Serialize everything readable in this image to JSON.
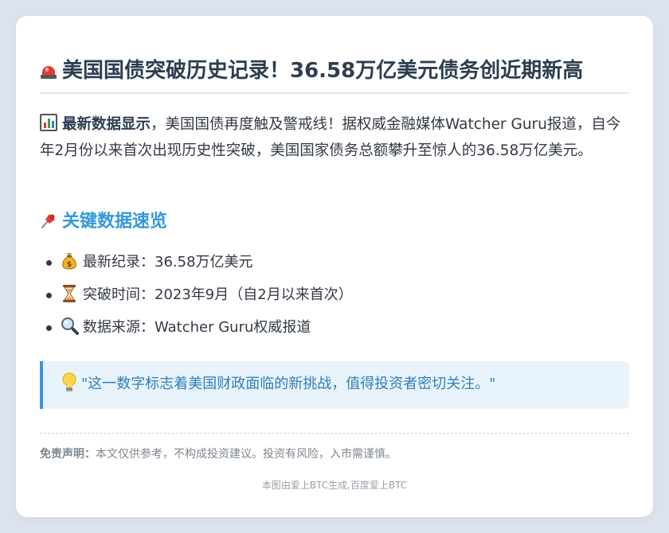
{
  "title": {
    "icon": "siren-icon",
    "text": "美国国债突破历史记录！36.58万亿美元债务创近期新高"
  },
  "intro": {
    "icon": "bar-chart-icon",
    "lead": "最新数据显示",
    "body": "，美国国债再度触及警戒线！据权威金融媒体Watcher Guru报道，自今年2月份以来首次出现历史性突破，美国国家债务总额攀升至惊人的36.58万亿美元。"
  },
  "section": {
    "icon": "pushpin-icon",
    "heading": "关键数据速览"
  },
  "facts": [
    {
      "icon": "money-bag-icon",
      "text": "最新纪录：36.58万亿美元"
    },
    {
      "icon": "hourglass-icon",
      "text": "突破时间：2023年9月（自2月以来首次）"
    },
    {
      "icon": "magnifier-icon",
      "text": "数据来源：Watcher Guru权威报道"
    }
  ],
  "quote": {
    "icon": "light-bulb-icon",
    "text": "\"这一数字标志着美国财政面临的新挑战，值得投资者密切关注。\""
  },
  "disclaimer": {
    "label": "免责声明：",
    "text": "本文仅供参考，不构成投资建议。投资有风险，入市需谨慎。"
  },
  "footer": {
    "text": "本图由爱上BTC生成,百度爱上BTC"
  },
  "colors": {
    "page_background": "#dde3ee",
    "card": "#ffffff",
    "title_text": "#2c3e50",
    "accent": "#3498db",
    "quote_background": "#e9f3fb",
    "quote_text": "#2f7fb8",
    "muted": "#7f8790"
  }
}
